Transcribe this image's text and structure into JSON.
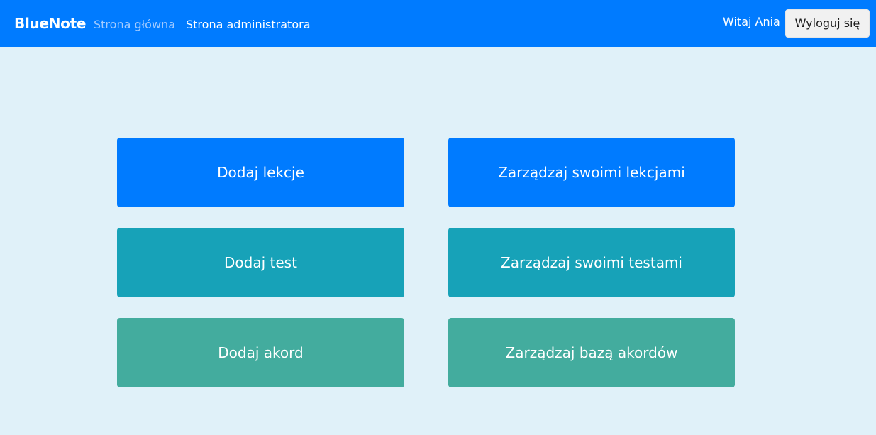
{
  "navbar": {
    "brand": "BlueNote",
    "links": [
      "Strona główna",
      "Strona administratora"
    ],
    "greeting": "Witaj Ania",
    "logout_label": "Wyloguj się"
  },
  "tiles": [
    {
      "label": "Dodaj lekcje",
      "color": "#007bff"
    },
    {
      "label": "Zarządzaj swoimi lekcjami",
      "color": "#007bff"
    },
    {
      "label": "Dodaj test",
      "color": "#17a2b8"
    },
    {
      "label": "Zarządzaj swoimi testami",
      "color": "#17a2b8"
    },
    {
      "label": "Dodaj akord",
      "color": "#43ac9e"
    },
    {
      "label": "Zarządzaj bazą akordów",
      "color": "#43ac9e"
    }
  ],
  "colors": {
    "navbar": "#007bff",
    "background": "#e0f1f9"
  }
}
